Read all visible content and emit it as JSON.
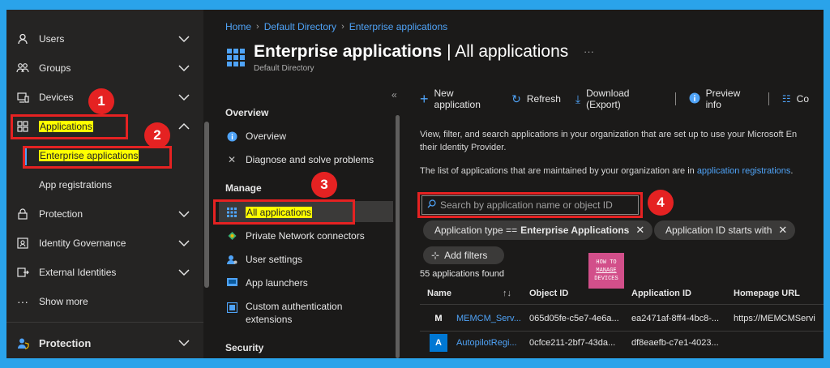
{
  "leftnav": {
    "items": [
      {
        "label": "Users",
        "icon": "person-icon"
      },
      {
        "label": "Groups",
        "icon": "group-icon"
      },
      {
        "label": "Devices",
        "icon": "device-icon"
      },
      {
        "label": "Applications",
        "icon": "applications-icon"
      },
      {
        "label": "Protection",
        "icon": "lock-icon"
      },
      {
        "label": "Identity Governance",
        "icon": "identity-governance-icon"
      },
      {
        "label": "External Identities",
        "icon": "external-identities-icon"
      },
      {
        "label": "Show more",
        "icon": "ellipsis-icon"
      },
      {
        "label": "Protection",
        "icon": "protection-icon"
      }
    ],
    "sub_items": [
      "Enterprise applications",
      "App registrations"
    ]
  },
  "badges": [
    "1",
    "2",
    "3",
    "4"
  ],
  "breadcrumb": [
    "Home",
    "Default Directory",
    "Enterprise applications"
  ],
  "page": {
    "title_bold": "Enterprise applications",
    "title_rest": " | All applications",
    "more": "···",
    "subtitle": "Default Directory"
  },
  "midmenu": {
    "overview_head": "Overview",
    "overview": "Overview",
    "diagnose": "Diagnose and solve problems",
    "manage_head": "Manage",
    "all_apps": "All applications",
    "private_network": "Private Network connectors",
    "user_settings": "User settings",
    "app_launchers": "App launchers",
    "custom_auth_1": "Custom authentication",
    "custom_auth_2": "extensions",
    "security_head": "Security",
    "collapse": "«"
  },
  "toolbar": {
    "new_app": "New application",
    "refresh": "Refresh",
    "download": "Download (Export)",
    "preview": "Preview info",
    "columns": "Co"
  },
  "content": {
    "desc_line1": "View, filter, and search applications in your organization that are set up to use your Microsoft En",
    "desc_line2": "their Identity Provider.",
    "desc2_text": "The list of applications that are maintained by your organization are in ",
    "desc2_link": "application registrations",
    "desc2_end": ".",
    "search_placeholder": "Search by application name or object ID",
    "filter1_label": "Application type ==",
    "filter1_value": "Enterprise Applications",
    "filter2_label": "Application ID starts with",
    "add_filters": "Add filters",
    "found": "55 applications found"
  },
  "logo": {
    "line1": "HOW TO",
    "line2": "MANAGE",
    "line3": "DEVICES"
  },
  "table": {
    "headers": [
      "Name",
      "Object ID",
      "Application ID",
      "Homepage URL"
    ],
    "rows": [
      {
        "initial": "M",
        "color": "#1b1a19",
        "name": "MEMCM_Serv...",
        "object_id": "065d05fe-c5e7-4e6a...",
        "app_id": "ea2471af-8ff4-4bc8-...",
        "homepage": "https://MEMCMServi"
      },
      {
        "initial": "A",
        "color": "#0078d4",
        "name": "AutopilotRegi...",
        "object_id": "0cfce211-2bf7-43da...",
        "app_id": "df8eaefb-c7e1-4023...",
        "homepage": ""
      }
    ]
  },
  "colors": {
    "accent": "#4fa3f7",
    "annotation": "#e52222",
    "highlight": "#ffff00",
    "frame": "#2aa3ea"
  }
}
